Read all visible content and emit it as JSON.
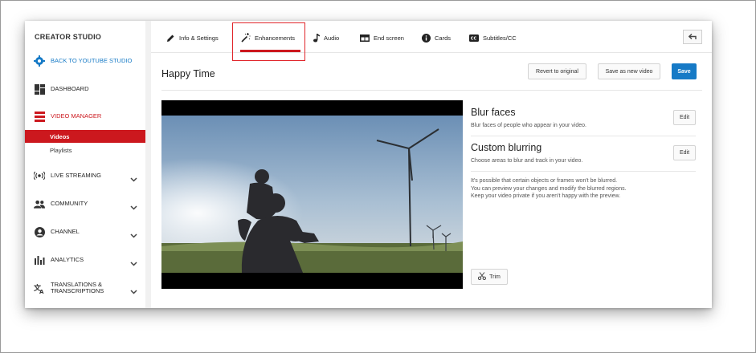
{
  "colors": {
    "accent_blue": "#167ac6",
    "accent_red": "#cc181e",
    "highlight_box": "#e0252a"
  },
  "sidebar": {
    "title": "CREATOR STUDIO",
    "items": [
      {
        "label": "BACK TO YOUTUBE STUDIO",
        "icon": "gear-icon"
      },
      {
        "label": "DASHBOARD",
        "icon": "dashboard-icon"
      },
      {
        "label": "VIDEO MANAGER",
        "icon": "video-manager-icon"
      },
      {
        "label": "LIVE STREAMING",
        "icon": "live-streaming-icon"
      },
      {
        "label": "COMMUNITY",
        "icon": "community-icon"
      },
      {
        "label": "CHANNEL",
        "icon": "channel-icon"
      },
      {
        "label": "ANALYTICS",
        "icon": "analytics-icon"
      },
      {
        "label": "TRANSLATIONS & TRANSCRIPTIONS",
        "icon": "translate-icon"
      }
    ],
    "sub_items": [
      {
        "label": "Videos",
        "active": true
      },
      {
        "label": "Playlists",
        "active": false
      }
    ]
  },
  "tabs": [
    {
      "label": "Info & Settings",
      "icon": "pencil-icon"
    },
    {
      "label": "Enhancements",
      "icon": "magic-wand-icon",
      "active": true
    },
    {
      "label": "Audio",
      "icon": "music-note-icon"
    },
    {
      "label": "End screen",
      "icon": "end-screen-icon"
    },
    {
      "label": "Cards",
      "icon": "info-icon"
    },
    {
      "label": "Subtitles/CC",
      "icon": "cc-icon"
    }
  ],
  "header": {
    "title": "Happy Time",
    "revert_label": "Revert to original",
    "save_new_label": "Save as new video",
    "save_label": "Save"
  },
  "options": {
    "blur_faces": {
      "title": "Blur faces",
      "desc": "Blur faces of people who appear in your video.",
      "edit": "Edit"
    },
    "custom_blurring": {
      "title": "Custom blurring",
      "desc": "Choose areas to blur and track in your video.",
      "edit": "Edit"
    },
    "note": "It's possible that certain objects or frames won't be blurred. You can preview your changes and modify the blurred regions. Keep your video private if you aren't happy with the preview.",
    "trim_label": "Trim"
  }
}
